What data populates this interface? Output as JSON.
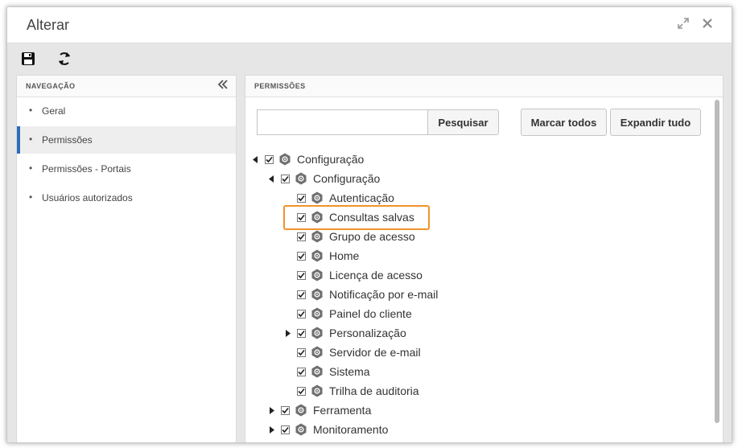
{
  "window": {
    "title": "Alterar",
    "maximize_icon": "expand-icon",
    "close_icon": "close-icon"
  },
  "toolbar": {
    "save_icon": "save-icon",
    "refresh_icon": "refresh-icon"
  },
  "navigation": {
    "header": "NAVEGAÇÃO",
    "items": [
      {
        "label": "Geral"
      },
      {
        "label": "Permissões"
      },
      {
        "label": "Permissões - Portais"
      },
      {
        "label": "Usuários autorizados"
      }
    ],
    "active_index": 1
  },
  "permissions": {
    "header": "PERMISSÕES",
    "search": {
      "value": "",
      "placeholder": ""
    },
    "buttons": {
      "search": "Pesquisar",
      "select_all": "Marcar todos",
      "expand_all": "Expandir tudo"
    },
    "tree": [
      {
        "label": "Configuração",
        "arrow": "expanded",
        "checked": true
      },
      {
        "label": "Configuração",
        "arrow": "expanded",
        "checked": true
      },
      {
        "label": "Autenticação",
        "arrow": "none",
        "checked": true
      },
      {
        "label": "Consultas salvas",
        "arrow": "none",
        "checked": true,
        "highlighted": true
      },
      {
        "label": "Grupo de acesso",
        "arrow": "none",
        "checked": true
      },
      {
        "label": "Home",
        "arrow": "none",
        "checked": true
      },
      {
        "label": "Licença de acesso",
        "arrow": "none",
        "checked": true
      },
      {
        "label": "Notificação por e-mail",
        "arrow": "none",
        "checked": true
      },
      {
        "label": "Painel do cliente",
        "arrow": "none",
        "checked": true
      },
      {
        "label": "Personalização",
        "arrow": "collapsed",
        "checked": true
      },
      {
        "label": "Servidor de e-mail",
        "arrow": "none",
        "checked": true
      },
      {
        "label": "Sistema",
        "arrow": "none",
        "checked": true
      },
      {
        "label": "Trilha de auditoria",
        "arrow": "none",
        "checked": true
      },
      {
        "label": "Ferramenta",
        "arrow": "collapsed",
        "checked": true
      },
      {
        "label": "Monitoramento",
        "arrow": "collapsed",
        "checked": true
      }
    ]
  },
  "colors": {
    "accent": "#2a6ebb",
    "highlight": "#f0932b",
    "gear": "#6f6f6f"
  }
}
